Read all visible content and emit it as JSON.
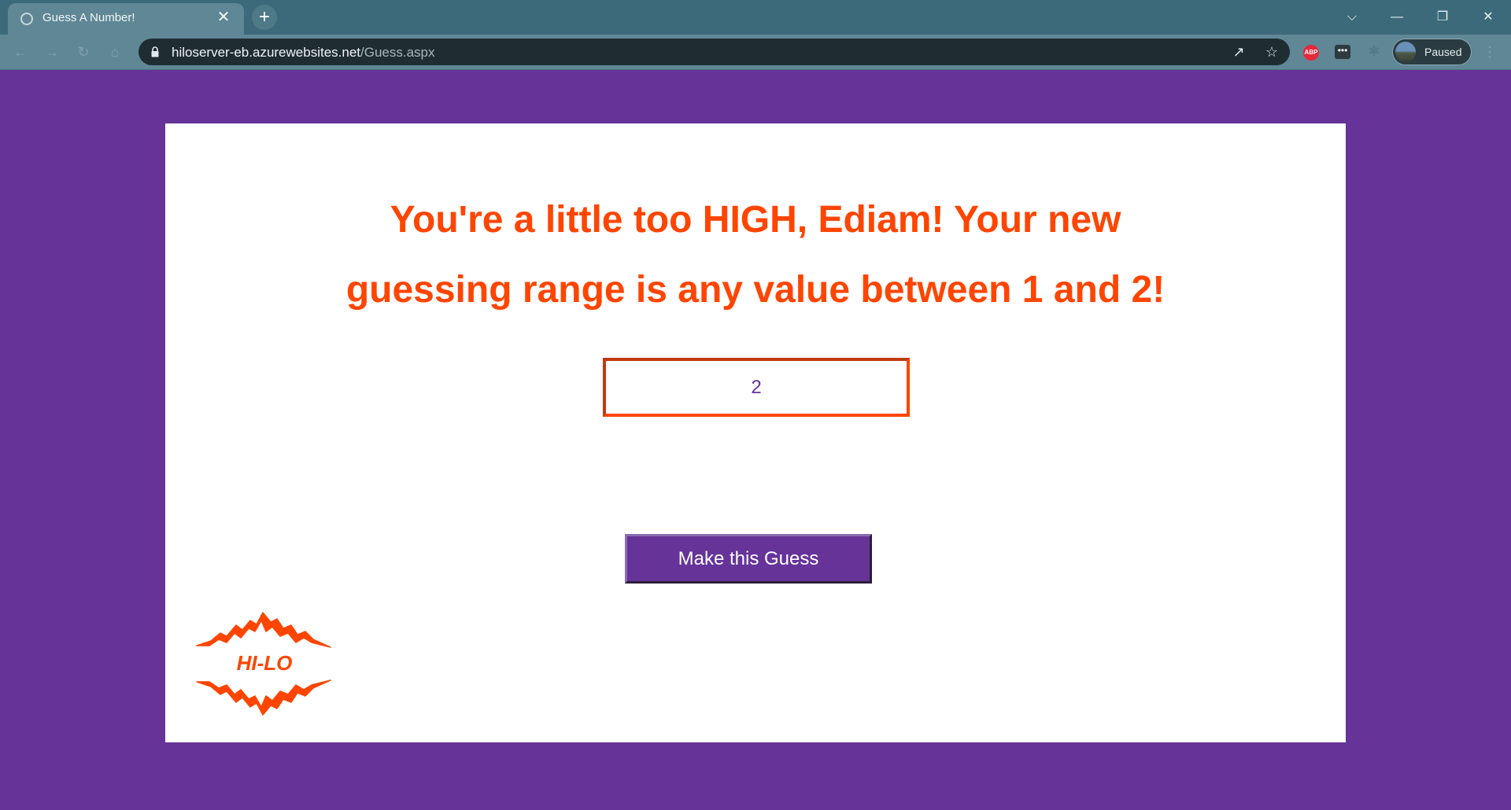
{
  "browser": {
    "tab_title": "Guess A Number!",
    "tab_close": "✕",
    "new_tab": "+",
    "url_host": "hiloserver-eb.azurewebsites.net",
    "url_path": "/Guess.aspx",
    "profile_label": "Paused",
    "ext_abp_label": "ABP",
    "ext_dots_label": "•••",
    "window_controls": {
      "dropdown": "⌵",
      "minimize": "—",
      "restore": "❐",
      "close": "✕"
    }
  },
  "page": {
    "headline_line1": "You're a little too HIGH, Ediam! Your new",
    "headline_line2": "guessing range is any value between 1 and 2!",
    "guess_value": "2",
    "button_label": "Make this Guess",
    "logo_text": "HI-LO"
  },
  "colors": {
    "background": "#663399",
    "accent": "#ff4500",
    "card": "#ffffff"
  }
}
